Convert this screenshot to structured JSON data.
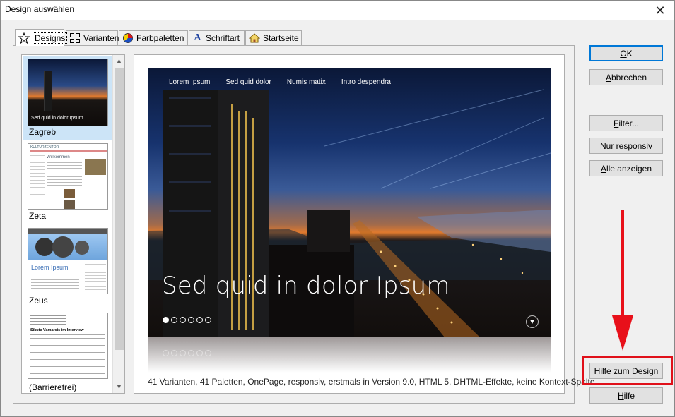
{
  "window": {
    "title": "Design auswählen",
    "close_glyph": "✕"
  },
  "tabs": [
    {
      "label": "Designs",
      "icon": "star-icon"
    },
    {
      "label": "Varianten",
      "icon": "grid-icon"
    },
    {
      "label": "Farbpaletten",
      "icon": "palette-icon"
    },
    {
      "label": "Schriftart",
      "icon": "font-icon"
    },
    {
      "label": "Startseite",
      "icon": "home-icon"
    }
  ],
  "designs": [
    {
      "name": "Zagreb",
      "selected": true
    },
    {
      "name": "Zeta",
      "selected": false
    },
    {
      "name": "Zeus",
      "selected": false
    },
    {
      "name": "(Barrierefrei)",
      "selected": false
    }
  ],
  "thumb_texts": {
    "zagreb_caption": "Sed quid in dolor Ipsum",
    "zeta_header": "KULTURZENTOR",
    "zeta_title": "Willkommen",
    "zeus_title": "Lorem Ipsum",
    "barriere_title": "Sikuta Vamarsis im Interview"
  },
  "preview": {
    "nav": [
      "Lorem Ipsum",
      "Sed quid dolor",
      "Numis matix",
      "Intro despendra"
    ],
    "headline": "Sed quid in dolor Ipsum",
    "slide_dots": 6,
    "active_dot": 0
  },
  "description": "41 Varianten, 41 Paletten, OnePage, responsiv, erstmals in Version 9.0, HTML 5, DHTML-Effekte, keine Kontext-Spalte",
  "buttons": {
    "ok": {
      "first": "O",
      "rest": "K"
    },
    "cancel": {
      "first": "A",
      "rest": "bbrechen"
    },
    "filter": {
      "first": "F",
      "rest": "ilter..."
    },
    "responsive": {
      "first": "N",
      "rest": "ur responsiv"
    },
    "show_all": {
      "first": "A",
      "rest": "lle anzeigen"
    },
    "design_help": {
      "first": "H",
      "rest": "ilfe zum Design"
    },
    "help": {
      "first": "H",
      "rest": "ilfe"
    }
  },
  "colors": {
    "accent": "#0078d7",
    "annotation": "#e0101a",
    "selection": "#cce4f7"
  }
}
